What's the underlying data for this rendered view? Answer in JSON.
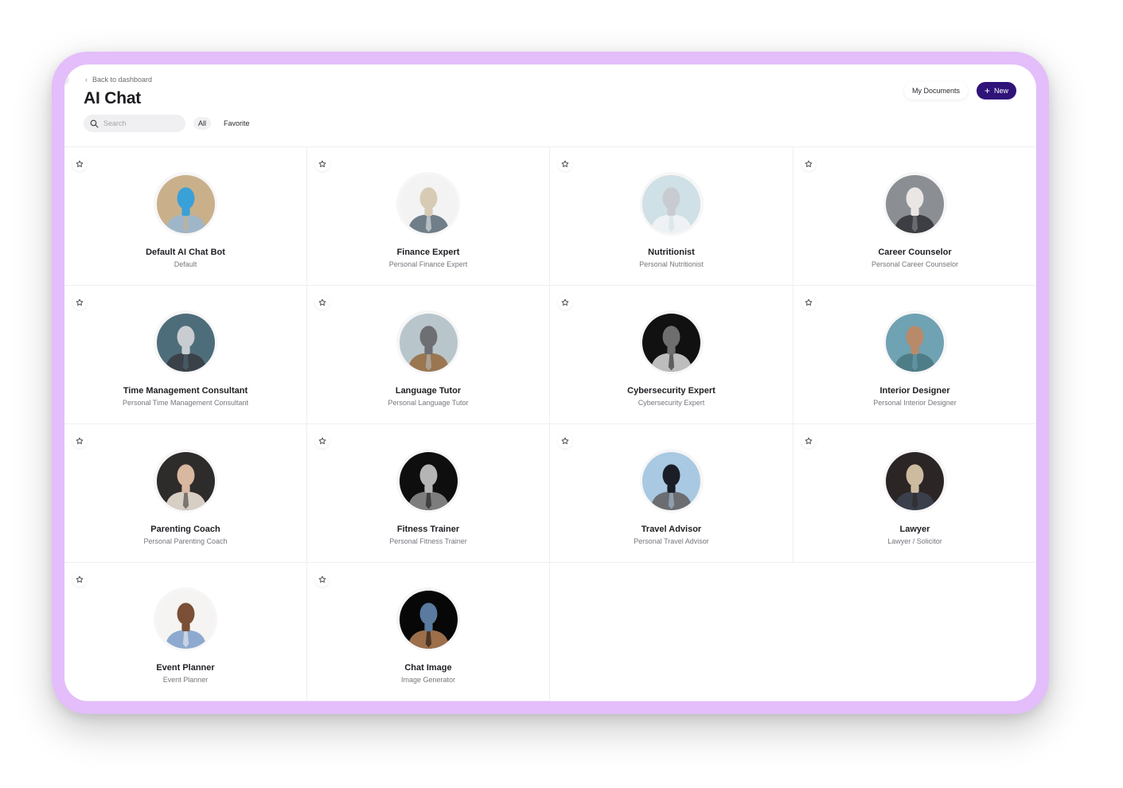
{
  "header": {
    "back_label": "Back to dashboard",
    "title": "AI Chat",
    "search_placeholder": "Search",
    "search_value": "",
    "filters": [
      {
        "label": "All",
        "active": true
      },
      {
        "label": "Favorite",
        "active": false
      }
    ],
    "my_documents_label": "My Documents",
    "new_label": "New"
  },
  "colors": {
    "frame": "#e4bdfb",
    "primary": "#2f1379"
  },
  "assistants": [
    {
      "title": "Default AI Chat Bot",
      "subtitle": "Default",
      "favorite": false,
      "avatar": {
        "bg": "#c9b08a",
        "fg": "#9fb6c8",
        "accent": "#3aa0d8"
      }
    },
    {
      "title": "Finance Expert",
      "subtitle": "Personal Finance Expert",
      "favorite": false,
      "avatar": {
        "bg": "#f3f3f3",
        "fg": "#6f7e88",
        "accent": "#d8cbb6"
      }
    },
    {
      "title": "Nutritionist",
      "subtitle": "Personal Nutritionist",
      "favorite": false,
      "avatar": {
        "bg": "#cfe0e6",
        "fg": "#eef2f4",
        "accent": "#c8ccd0"
      }
    },
    {
      "title": "Career Counselor",
      "subtitle": "Personal Career Counselor",
      "favorite": false,
      "avatar": {
        "bg": "#8b8e93",
        "fg": "#3c3e43",
        "accent": "#e9e6e3"
      }
    },
    {
      "title": "Time Management Consultant",
      "subtitle": "Personal Time Management Consultant",
      "favorite": false,
      "avatar": {
        "bg": "#4e6d7a",
        "fg": "#3a4148",
        "accent": "#c9cdd1"
      }
    },
    {
      "title": "Language Tutor",
      "subtitle": "Personal Language Tutor",
      "favorite": false,
      "avatar": {
        "bg": "#b8c6cc",
        "fg": "#9a7651",
        "accent": "#6d6f72"
      }
    },
    {
      "title": "Cybersecurity Expert",
      "subtitle": "Cybersecurity Expert",
      "favorite": false,
      "avatar": {
        "bg": "#111111",
        "fg": "#bdbdbd",
        "accent": "#6e6e6e"
      }
    },
    {
      "title": "Interior Designer",
      "subtitle": "Personal Interior Designer",
      "favorite": false,
      "avatar": {
        "bg": "#6fa2b2",
        "fg": "#4e7d87",
        "accent": "#b98a6a"
      }
    },
    {
      "title": "Parenting Coach",
      "subtitle": "Personal Parenting Coach",
      "favorite": false,
      "avatar": {
        "bg": "#2e2b2b",
        "fg": "#d7cfc4",
        "accent": "#d9b8a0"
      }
    },
    {
      "title": "Fitness Trainer",
      "subtitle": "Personal Fitness Trainer",
      "favorite": false,
      "avatar": {
        "bg": "#0e0e0e",
        "fg": "#7d7d7d",
        "accent": "#b5b5b5"
      }
    },
    {
      "title": "Travel Advisor",
      "subtitle": "Personal Travel Advisor",
      "favorite": false,
      "avatar": {
        "bg": "#a9c9e2",
        "fg": "#6b6d71",
        "accent": "#1b1e27"
      }
    },
    {
      "title": "Lawyer",
      "subtitle": "Lawyer / Solicitor",
      "favorite": false,
      "avatar": {
        "bg": "#2b2525",
        "fg": "#3a3f4b",
        "accent": "#cdbba0"
      }
    },
    {
      "title": "Event Planner",
      "subtitle": "Event Planner",
      "favorite": false,
      "avatar": {
        "bg": "#f6f4f2",
        "fg": "#8ea9cf",
        "accent": "#7a4f36"
      }
    },
    {
      "title": "Chat Image",
      "subtitle": "Image Generator",
      "favorite": false,
      "avatar": {
        "bg": "#070707",
        "fg": "#9c6e4a",
        "accent": "#5a7aa0"
      }
    }
  ]
}
